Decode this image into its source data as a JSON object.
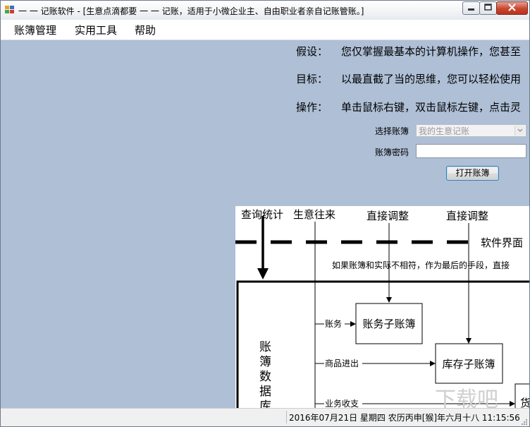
{
  "window": {
    "title": "一 一 记账软件 - [生意点滴都要 一 一 记账，适用于小微企业主、自由职业者亲自记账管账。]",
    "colors": {
      "client_bg": "#aebfd6",
      "close_button": "#c9452f"
    }
  },
  "menu": {
    "items": [
      "账簿管理",
      "实用工具",
      "帮助"
    ]
  },
  "intro": {
    "lines": [
      {
        "label": "假设：",
        "text": "您仅掌握最基本的计算机操作，您甚至"
      },
      {
        "label": "目标：",
        "text": "以最直截了当的思维，您可以轻松使用"
      },
      {
        "label": "操作：",
        "text": "单击鼠标右键，双击鼠标左键，点击灵"
      }
    ]
  },
  "form": {
    "ledger_label": "选择账簿",
    "ledger_value": "我的生意记账",
    "password_label": "账簿密码",
    "password_value": "",
    "open_button": "打开账簿"
  },
  "diagram": {
    "top_labels": [
      "查询统计",
      "生意往来",
      "直接调整",
      "直接调整"
    ],
    "ui_label": "软件界面",
    "note": "如果账簿和实际不相符，作为最后的手段，直接",
    "db_label": [
      "账",
      "簿",
      "数",
      "据",
      "库"
    ],
    "branches": [
      "账务",
      "商品进出",
      "业务收支"
    ],
    "boxes": [
      "账务子账簿",
      "库存子账簿"
    ],
    "partial_box_char": "货"
  },
  "status": {
    "datetime": "2016年07月21日  星期四  农历丙申[猴]年六月十八  11:15:56"
  },
  "watermark": "下载吧"
}
